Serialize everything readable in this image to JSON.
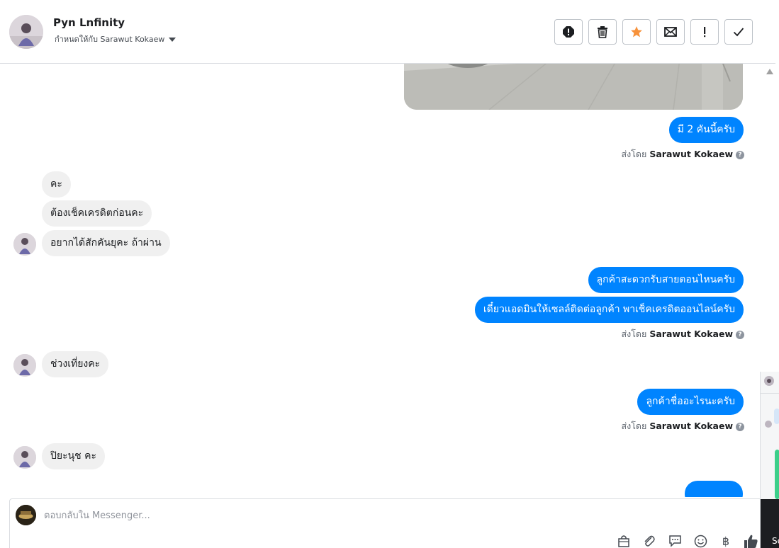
{
  "header": {
    "contact_name": "Pyn Lnfinity",
    "assigned_label": "กำหนดให้กับ Sarawut Kokaew",
    "toolbar": [
      "mark-spam",
      "delete",
      "star",
      "mark-unread",
      "follow-up",
      "done"
    ]
  },
  "thread": {
    "messages": [
      {
        "side": "out",
        "text": "มี 2 คันนี้ครับ"
      },
      {
        "side": "meta",
        "prefix": "ส่งโดย",
        "sender": "Sarawut Kokaew"
      },
      {
        "side": "in",
        "text": "คะ"
      },
      {
        "side": "in",
        "text": "ต้องเช็คเครดิตก่อนคะ"
      },
      {
        "side": "in",
        "text": "อยากได้สักคันยุคะ ถ้าผ่าน"
      },
      {
        "side": "out",
        "text": "ลูกค้าสะดวกรับสายตอนไหนครับ"
      },
      {
        "side": "out",
        "text": "เดี๋ยวแอดมินให้เซลล์ติดต่อลูกค้า พาเช็คเครดิตออนไลน์ครับ"
      },
      {
        "side": "meta",
        "prefix": "ส่งโดย",
        "sender": "Sarawut Kokaew"
      },
      {
        "side": "in",
        "text": "ช่วงเที่ยงคะ"
      },
      {
        "side": "out",
        "text": "ลูกค้าชื่ออะไรนะครับ"
      },
      {
        "side": "meta",
        "prefix": "ส่งโดย",
        "sender": "Sarawut Kokaew"
      },
      {
        "side": "in",
        "text": "ปิยะนุช คะ"
      }
    ]
  },
  "composer": {
    "placeholder": "ตอบกลับใน Messenger...",
    "baht_symbol": "฿"
  },
  "side_panel": {
    "partial_text": "Se"
  },
  "colors": {
    "outgoing_bubble": "#0084ff",
    "incoming_bubble": "#f0f0f0",
    "star": "#f7923b",
    "like": "#444950"
  }
}
